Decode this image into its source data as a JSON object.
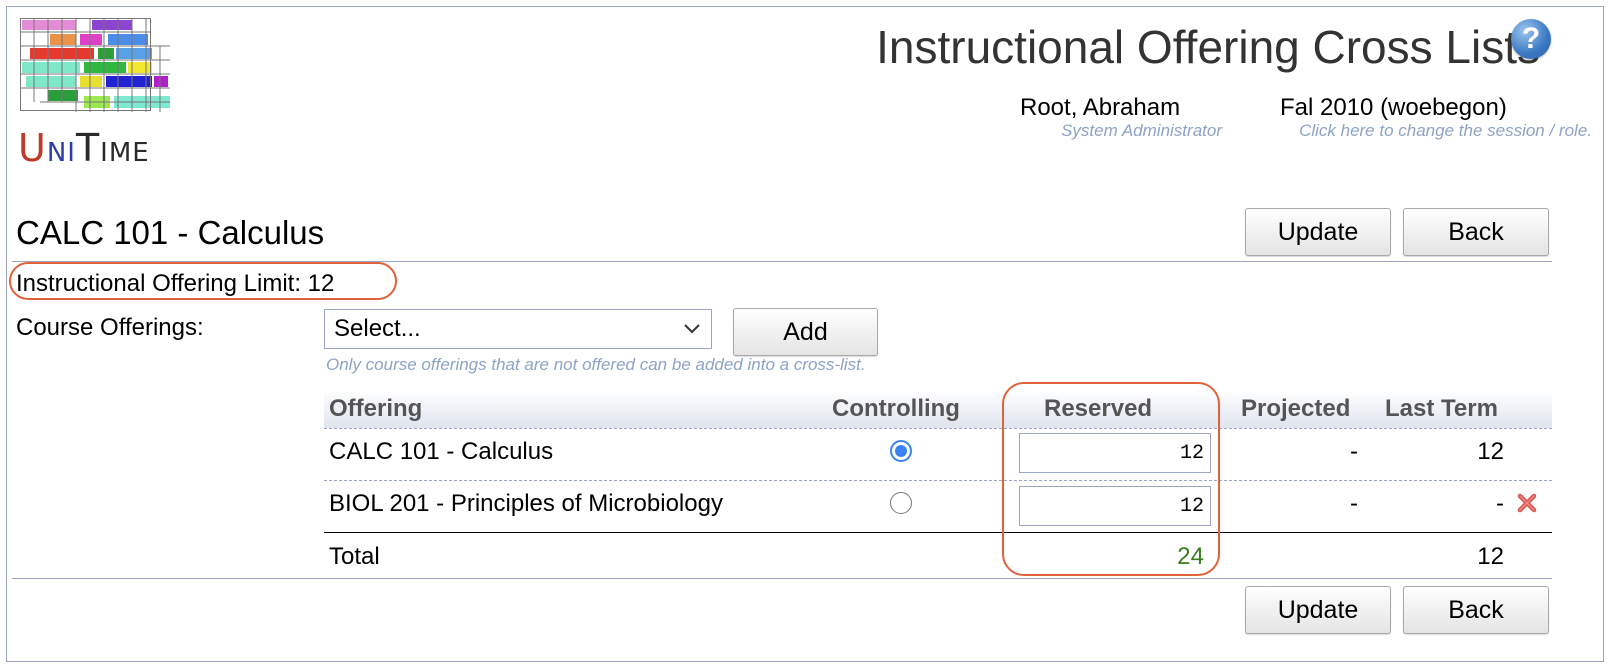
{
  "header": {
    "logo": {
      "u": "U",
      "ni": "NI",
      "t": "T",
      "ime": "IME"
    },
    "title": "Instructional Offering Cross Lists",
    "help_icon": "help-icon",
    "user": {
      "name": "Root, Abraham",
      "role": "System Administrator"
    },
    "session": {
      "name": "Fal 2010 (woebegon)",
      "hint": "Click here to change the session / role."
    }
  },
  "course": {
    "title": "CALC 101 - Calculus",
    "limit_label": "Instructional Offering Limit: 12"
  },
  "buttons": {
    "update": "Update",
    "back": "Back",
    "add": "Add"
  },
  "course_offerings": {
    "label": "Course Offerings:",
    "select_value": "Select...",
    "hint": "Only course offerings that are not offered can be added into a cross-list."
  },
  "table": {
    "headers": {
      "offering": "Offering",
      "controlling": "Controlling",
      "reserved": "Reserved",
      "projected": "Projected",
      "last_term": "Last Term"
    },
    "rows": [
      {
        "offering": "CALC 101 - Calculus",
        "controlling": true,
        "reserved": "12",
        "projected": "-",
        "last_term": "12",
        "removable": false
      },
      {
        "offering": "BIOL 201 - Principles of Microbiology",
        "controlling": false,
        "reserved": "12",
        "projected": "-",
        "last_term": "-",
        "removable": true
      }
    ],
    "total": {
      "label": "Total",
      "reserved": "24",
      "last_term": "12"
    }
  },
  "colors": {
    "accent_blue": "#3b82f6",
    "highlight_oval": "#e0623a",
    "total_green": "#3a7d1f",
    "hint_gray": "#8ea3c4",
    "delete_red": "#d9534f"
  }
}
